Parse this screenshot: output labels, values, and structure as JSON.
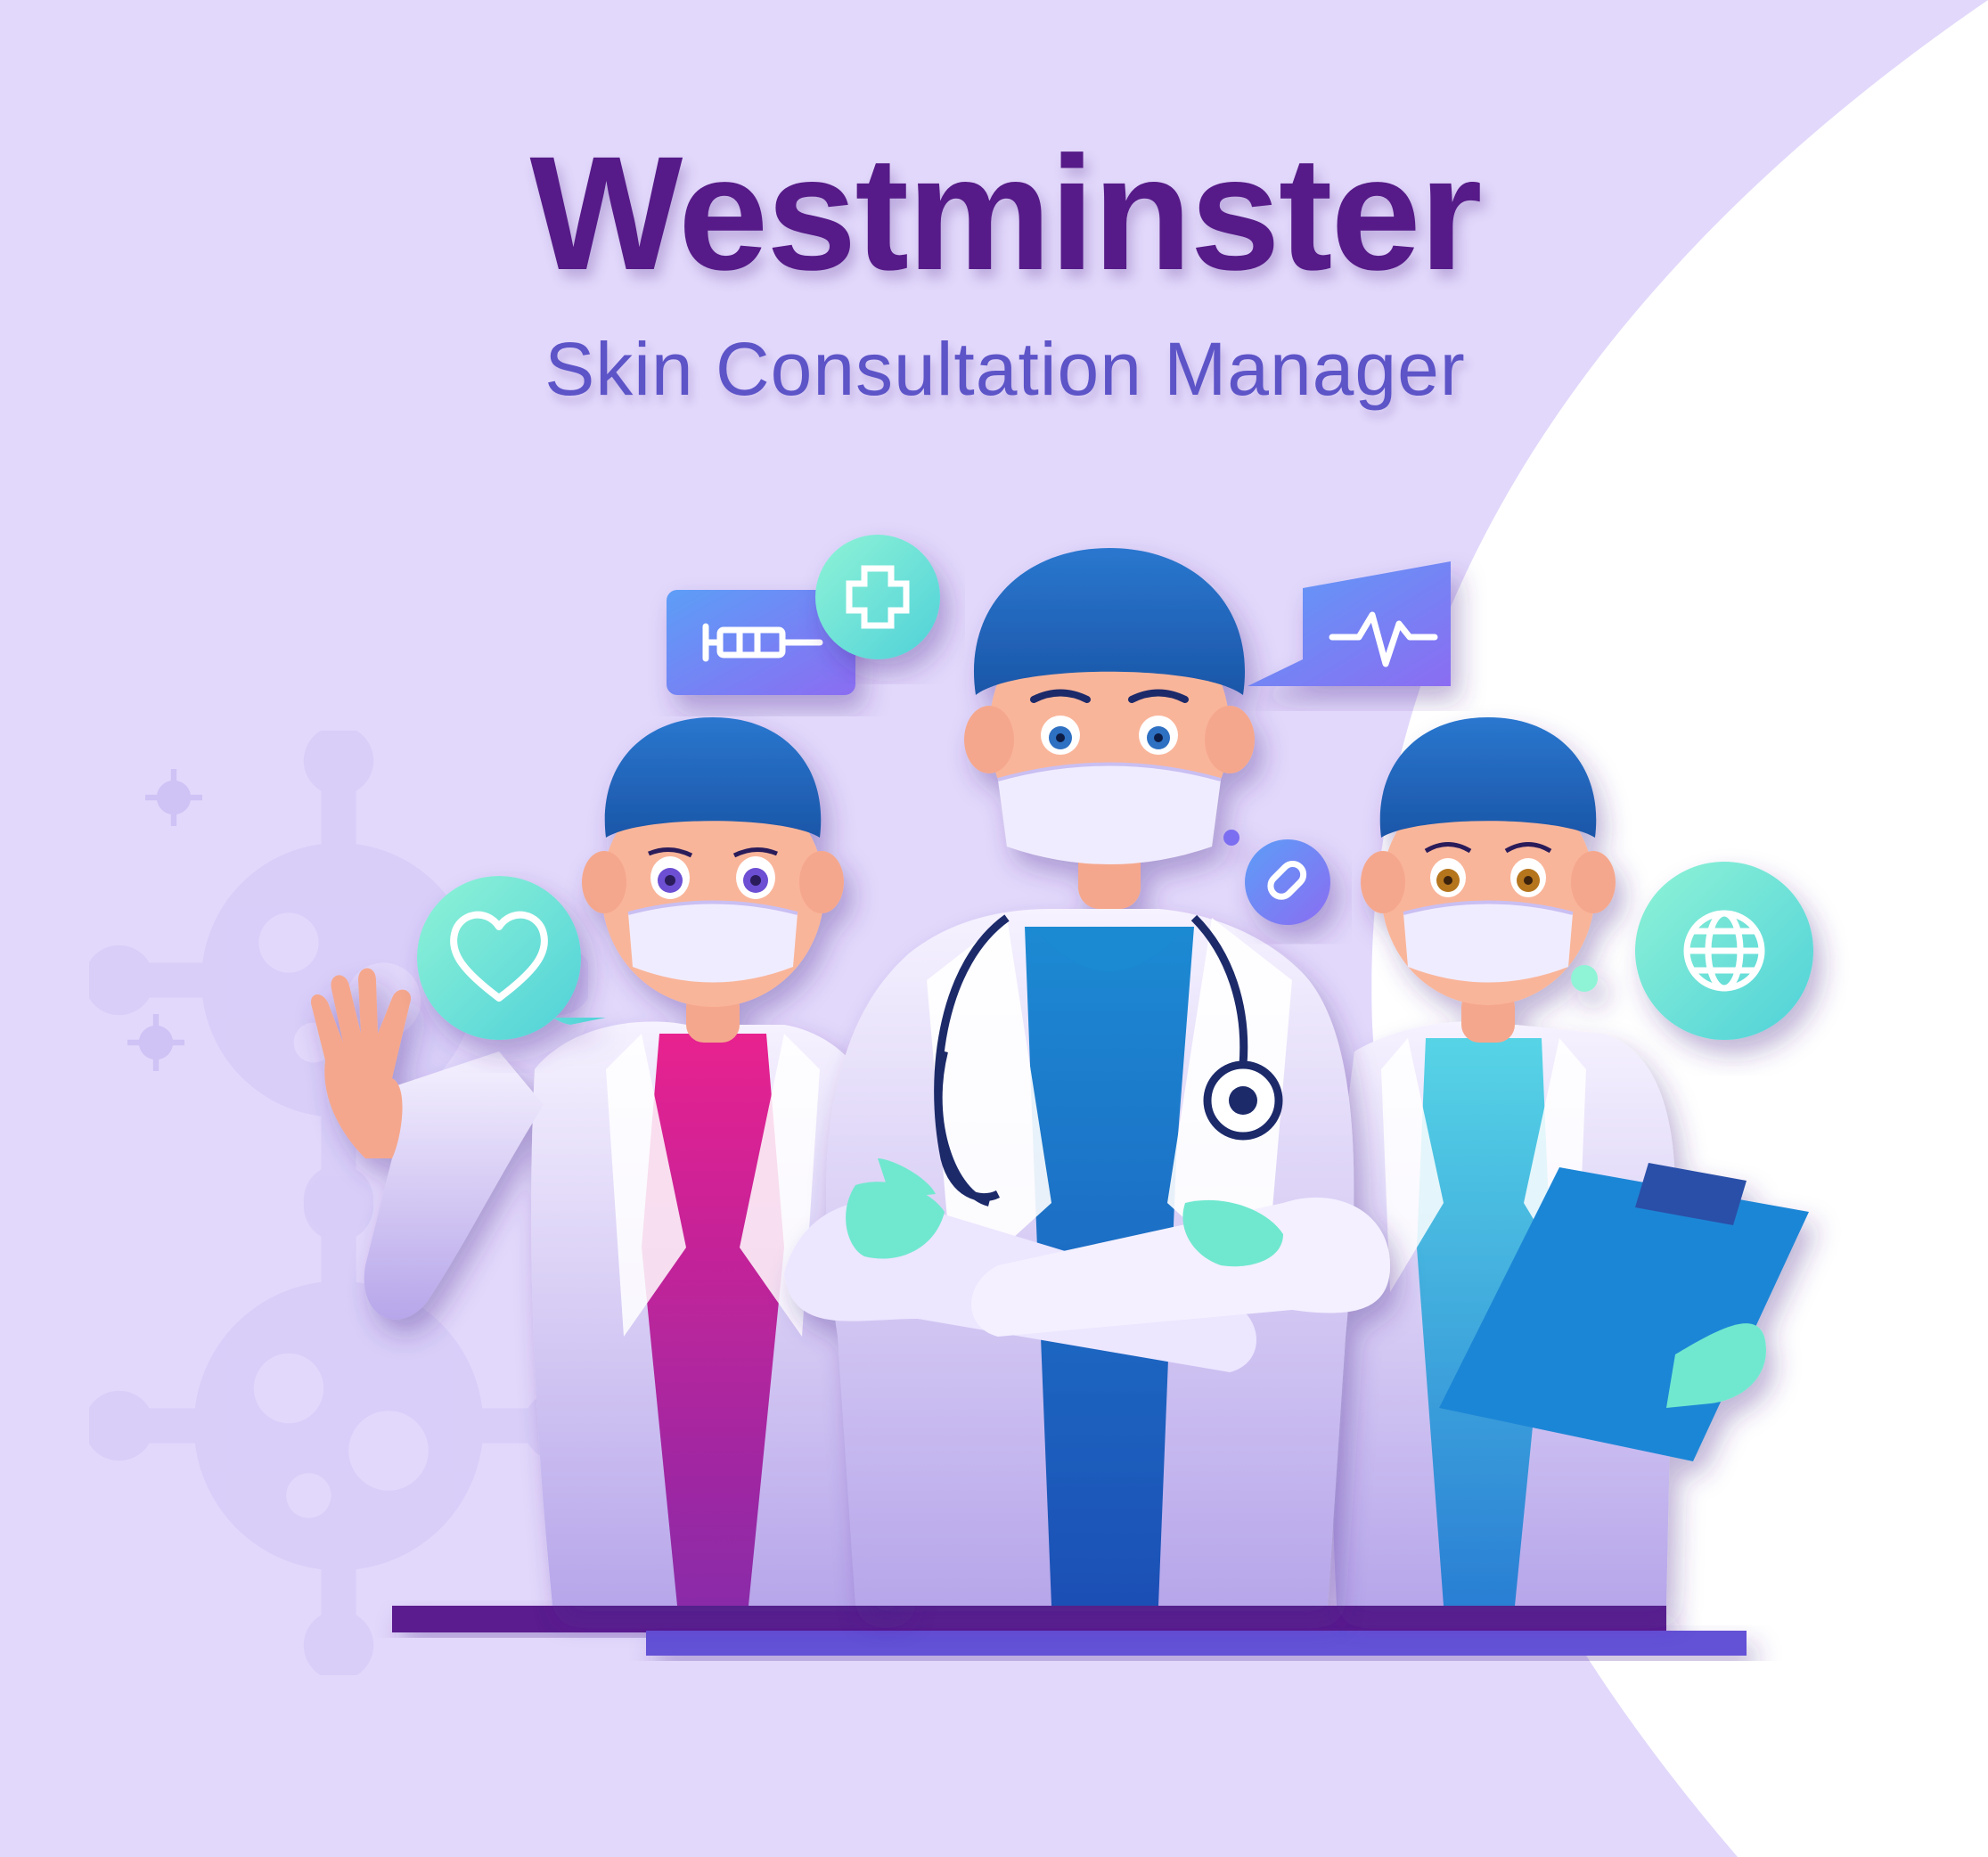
{
  "brand": {
    "title": "Westminster",
    "subtitle": "Skin Consultation Manager"
  },
  "colors": {
    "background": "#e2d8fb",
    "title": "#561b88",
    "subtitle": "#5d54c8",
    "scrub_blue": "#1d6fd0",
    "accent_mint": "#6fe8cf",
    "accent_violet": "#7b6ef0"
  },
  "icons": [
    "syringe-icon",
    "medical-cross-icon",
    "heartbeat-icon",
    "heart-icon",
    "pill-icon",
    "globe-icon",
    "virus-icon",
    "stethoscope-icon",
    "clipboard-icon"
  ]
}
